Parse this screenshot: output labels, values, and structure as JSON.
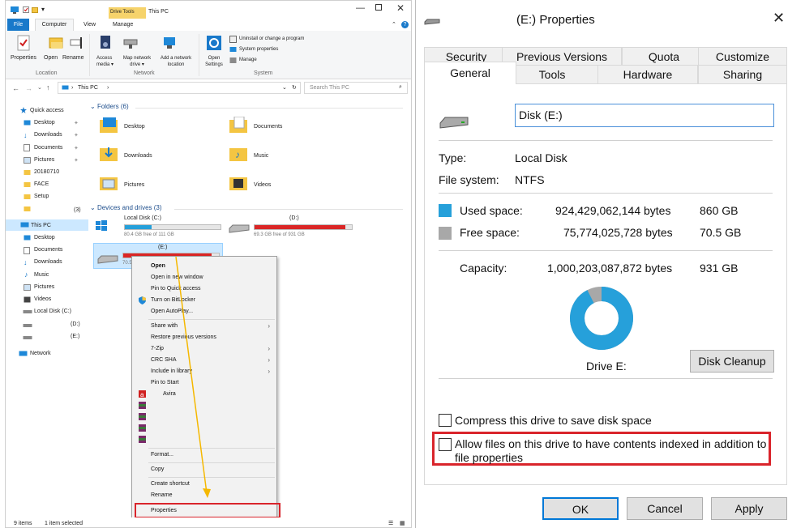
{
  "explorer": {
    "ribbon_group_label": "Drive Tools",
    "window_title": "This PC",
    "tabs": {
      "file": "File",
      "computer": "Computer",
      "view": "View",
      "manage": "Manage"
    },
    "ribbon": {
      "properties": "Properties",
      "open": "Open",
      "rename": "Rename",
      "access_media": "Access media ▾",
      "map_drive": "Map network drive ▾",
      "add_location": "Add a network location",
      "open_settings": "Open Settings",
      "uninstall": "Uninstall or change a program",
      "system_properties": "System properties",
      "manage": "Manage",
      "group_location": "Location",
      "group_network": "Network",
      "group_system": "System"
    },
    "address": {
      "path": "This PC",
      "search_placeholder": "Search This PC"
    },
    "nav": {
      "quick_access": "Quick access",
      "desktop": "Desktop",
      "downloads": "Downloads",
      "documents": "Documents",
      "pictures": "Pictures",
      "f1": "20180710",
      "f2": "FACE",
      "f3": "Setup",
      "f4_count": "(3)",
      "this_pc": "This PC",
      "pc_desktop": "Desktop",
      "pc_documents": "Documents",
      "pc_downloads": "Downloads",
      "pc_music": "Music",
      "pc_pictures": "Pictures",
      "pc_videos": "Videos",
      "pc_local": "Local Disk (C:)",
      "pc_d": "(D:)",
      "pc_e": "(E:)",
      "network": "Network"
    },
    "folders_header": "Folders (6)",
    "folders": {
      "desktop": "Desktop",
      "documents": "Documents",
      "downloads": "Downloads",
      "music": "Music",
      "pictures": "Pictures",
      "videos": "Videos"
    },
    "devices_header": "Devices and drives (3)",
    "drives": {
      "c_label": "Local Disk (C:)",
      "c_free": "80.4 GB free of 111 GB",
      "c_used_fraction": 0.28,
      "d_label": "(D:)",
      "d_free": "69.3 GB free of 931 GB",
      "d_used_fraction": 0.93,
      "e_label": "(E:)",
      "e_free_partial": "70.5",
      "e_used_fraction": 0.92
    },
    "context_menu": {
      "open": "Open",
      "open_new": "Open in new window",
      "pin_quick": "Pin to Quick access",
      "bitlocker": "Turn on BitLocker",
      "autoplay": "Open AutoPlay...",
      "share_with": "Share with",
      "restore": "Restore previous versions",
      "zip": "7-Zip",
      "crc": "CRC SHA",
      "library": "Include in library",
      "pin_start": "Pin to Start",
      "avira": "Avira",
      "format": "Format...",
      "copy": "Copy",
      "shortcut": "Create shortcut",
      "rename": "Rename",
      "properties": "Properties"
    },
    "status": {
      "items": "9 items",
      "selected": "1 item selected"
    },
    "colors": {
      "drive_bar": "#26a0da",
      "drive_bar_full": "#da2626",
      "highlight_box": "#d9242b",
      "arrow": "#f5b800"
    }
  },
  "props": {
    "title": "(E:) Properties",
    "tabs_row1": [
      "Security",
      "Previous Versions",
      "Quota",
      "Customize"
    ],
    "tabs_row2": [
      "General",
      "Tools",
      "Hardware",
      "Sharing"
    ],
    "name_value": "Disk (E:)",
    "type_label": "Type:",
    "type_value": "Local Disk",
    "fs_label": "File system:",
    "fs_value": "NTFS",
    "used_label": "Used space:",
    "used_bytes": "924,429,062,144 bytes",
    "used_size": "860 GB",
    "free_label": "Free space:",
    "free_bytes": "75,774,025,728 bytes",
    "free_size": "70.5 GB",
    "cap_label": "Capacity:",
    "cap_bytes": "1,000,203,087,872 bytes",
    "cap_size": "931 GB",
    "used_fraction": 0.924,
    "drive_label": "Drive E:",
    "cleanup": "Disk Cleanup",
    "compress": "Compress this drive to save disk space",
    "index_line1": "Allow files on this drive to have contents indexed in addition to",
    "index_line2": "file properties",
    "ok": "OK",
    "cancel": "Cancel",
    "apply": "Apply",
    "colors": {
      "used": "#26a0da",
      "free": "#a8a8a8"
    }
  }
}
